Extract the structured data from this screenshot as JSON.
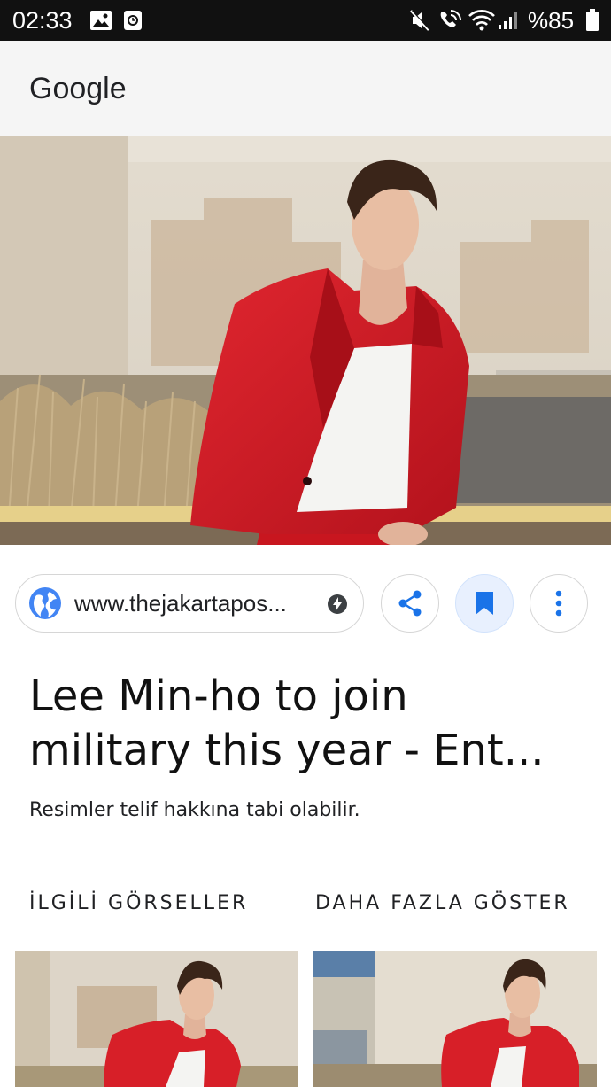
{
  "status_bar": {
    "time": "02:33",
    "battery": "%85",
    "icons": [
      "gallery-icon",
      "alarm-icon",
      "mute-icon",
      "wifi-calling-icon",
      "wifi-icon",
      "signal-icon",
      "battery-icon"
    ]
  },
  "app_bar": {
    "title": "Google"
  },
  "source": {
    "url": "www.thejakartapos...",
    "icon": "globe-icon",
    "badge_icon": "amp-bolt-icon"
  },
  "actions": {
    "share_icon": "share-icon",
    "save_icon": "bookmark-icon",
    "more_icon": "more-vert-icon"
  },
  "result": {
    "title_line1": "Lee Min-ho to join",
    "title_line2": "military this year - Ent...",
    "copyright_note": "Resimler telif hakkına tabi olabilir."
  },
  "related": {
    "label": "İLGİLİ GÖRSELLER",
    "more_label": "DAHA FAZLA GÖSTER"
  },
  "colors": {
    "status_bar_bg": "#111111",
    "app_bar_bg": "#f5f5f5",
    "accent_blue": "#4285f4",
    "saved_bg": "#e8f0fe"
  }
}
